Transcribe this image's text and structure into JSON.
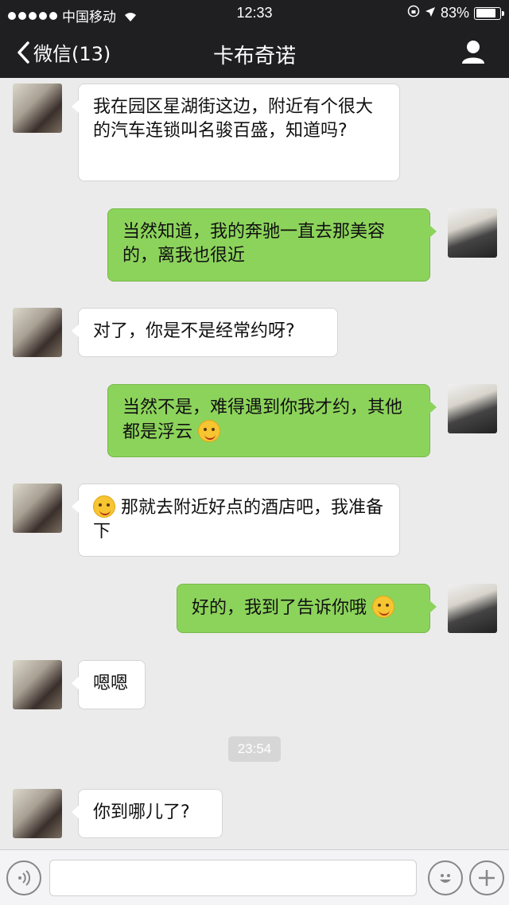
{
  "status_bar": {
    "carrier": "中国移动",
    "time": "12:33",
    "battery_percent": "83%",
    "battery_level": 0.83
  },
  "nav_bar": {
    "back_label": "微信(13)",
    "title": "卡布奇诺",
    "profile_icon": "person-icon"
  },
  "messages": [
    {
      "side": "left",
      "text": "我在园区星湖街这边，附近有个很大的汽车连锁叫名骏百盛，知道吗?"
    },
    {
      "side": "right",
      "text": "当然知道，我的奔驰一直去那美容的，离我也很近"
    },
    {
      "side": "left",
      "text": "对了，你是不是经常约呀?"
    },
    {
      "side": "right",
      "text": "当然不是，难得遇到你我才约，其他都是浮云",
      "emoji_after": "wink-emoji"
    },
    {
      "side": "left",
      "text": "那就去附近好点的酒店吧，我准备下",
      "emoji_before": "smile-emoji"
    },
    {
      "side": "right",
      "text": "好的，我到了告诉你哦",
      "emoji_after": "wink-emoji"
    },
    {
      "side": "left",
      "text": "嗯嗯"
    },
    {
      "side": "left",
      "text": "你到哪儿了?"
    }
  ],
  "timestamp": "23:54",
  "input_bar": {
    "voice_icon": "voice-icon",
    "input_value": "",
    "emoji_icon": "emoji-icon",
    "add_icon": "plus-icon"
  }
}
